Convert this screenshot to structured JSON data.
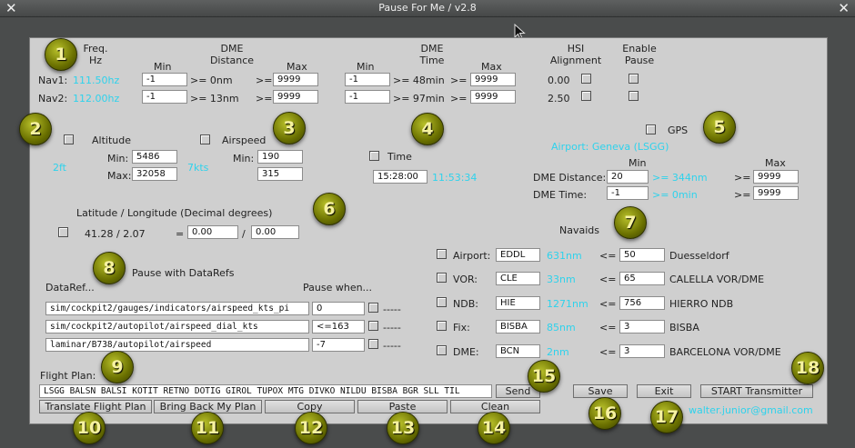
{
  "window": {
    "title": "Pause For Me / v2.8",
    "close_glyph": "✕"
  },
  "nav": {
    "freq_label": "Freq.\nHz",
    "dme_dist_label": "DME\nDistance",
    "dme_time_label": "DME\nTime",
    "hsi_label": "HSI\nAlignment",
    "enable_label": "Enable\nPause",
    "min": "Min",
    "max": "Max",
    "nav1": {
      "name": "Nav1:",
      "freq": "111.50hz",
      "dist_min": "-1",
      "dist_cur": ">= 0nm",
      "dist_max": "9999",
      "time_min": "-1",
      "time_cur": ">= 48min",
      "time_max": "9999",
      "hsi": "0.00"
    },
    "nav2": {
      "name": "Nav2:",
      "freq": "112.00hz",
      "dist_min": "-1",
      "dist_cur": ">= 13nm",
      "dist_max": "9999",
      "time_min": "-1",
      "time_cur": ">= 97min",
      "time_max": "9999",
      "hsi": "2.50"
    },
    "ge": ">="
  },
  "altitude": {
    "label": "Altitude",
    "current": "2ft",
    "min_label": "Min:",
    "max_label": "Max:",
    "min": "5486",
    "max": "32058"
  },
  "airspeed": {
    "label": "Airspeed",
    "current": "7kts",
    "min_label": "Min:",
    "min": "190",
    "max": "315"
  },
  "time": {
    "label": "Time",
    "value": "15:28:00",
    "current": "11:53:34"
  },
  "gps": {
    "label": "GPS",
    "airport": "Airport: Geneva  (LSGG)",
    "min": "Min",
    "max": "Max",
    "dist_label": "DME Distance:",
    "dist_min": "20",
    "dist_cur": ">= 344nm",
    "dist_max": "9999",
    "time_label": "DME Time:",
    "time_min": "-1",
    "time_cur": ">= 0min",
    "time_max": "9999",
    "ge": ">="
  },
  "latlon": {
    "label": "Latitude / Longitude (Decimal degrees)",
    "current": "41.28 / 2.07",
    "eq": "=",
    "lat": "0.00",
    "slash": "/",
    "lon": "0.00"
  },
  "navaids": {
    "label": "Navaids",
    "le": "<=",
    "rows": [
      {
        "type": "Airport:",
        "id": "EDDL",
        "dist": "631nm",
        "max": "50",
        "name": "Duesseldorf"
      },
      {
        "type": "VOR:",
        "id": "CLE",
        "dist": "33nm",
        "max": "65",
        "name": "CALELLA VOR/DME"
      },
      {
        "type": "NDB:",
        "id": "HIE",
        "dist": "1271nm",
        "max": "756",
        "name": "HIERRO NDB"
      },
      {
        "type": "Fix:",
        "id": "BISBA",
        "dist": "85nm",
        "max": "3",
        "name": "BISBA"
      },
      {
        "type": "DME:",
        "id": "BCN",
        "dist": "2nm",
        "max": "3",
        "name": "BARCELONA VOR/DME"
      }
    ]
  },
  "datarefs": {
    "label": "Pause with DataRefs",
    "col_ref": "DataRef...",
    "col_when": "Pause when...",
    "rows": [
      {
        "ref": "sim/cockpit2/gauges/indicators/airspeed_kts_pi",
        "when": "0",
        "status": "-----"
      },
      {
        "ref": "sim/cockpit2/autopilot/airspeed_dial_kts",
        "when": "<=163",
        "status": "-----"
      },
      {
        "ref": "laminar/B738/autopilot/airspeed",
        "when": "-7",
        "status": "-----"
      }
    ]
  },
  "flightplan": {
    "label": "Flight Plan:",
    "value": "LSGG BALSN BALSI KOTIT RETNO DOTIG GIROL TUPOX MTG DIVKO NILDU BISBA BGR SLL TIL",
    "send": "Send"
  },
  "buttons": {
    "translate": "Translate Flight Plan",
    "bring_back": "Bring Back My Plan",
    "copy": "Copy",
    "paste": "Paste",
    "clean": "Clean",
    "save": "Save",
    "exit": "Exit",
    "start": "START Transmitter"
  },
  "email": "walter.junior@gmail.com",
  "badges": [
    "1",
    "2",
    "3",
    "4",
    "5",
    "6",
    "7",
    "8",
    "9",
    "10",
    "11",
    "12",
    "13",
    "14",
    "15",
    "16",
    "17",
    "18"
  ]
}
